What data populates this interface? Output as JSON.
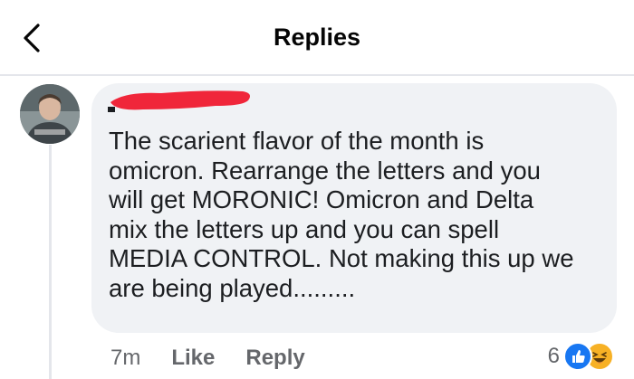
{
  "header": {
    "title": "Replies"
  },
  "comment": {
    "text": "The scarient flavor of the month is\nomicron. Rearrange the letters and you\nwill get MORONIC! Omicron and Delta\nmix the letters up and you can spell\nMEDIA CONTROL. Not making this up we\nare being played.........",
    "time": "7m",
    "like_label": "Like",
    "reply_label": "Reply",
    "reaction_count": "6",
    "reactions": [
      "like-icon",
      "haha-icon"
    ]
  },
  "colors": {
    "bubble": "#f0f2f5",
    "redaction": "#f0263a",
    "like_blue": "#1877f2",
    "haha_yellow": "#f7b125",
    "secondary_text": "#65676b"
  }
}
